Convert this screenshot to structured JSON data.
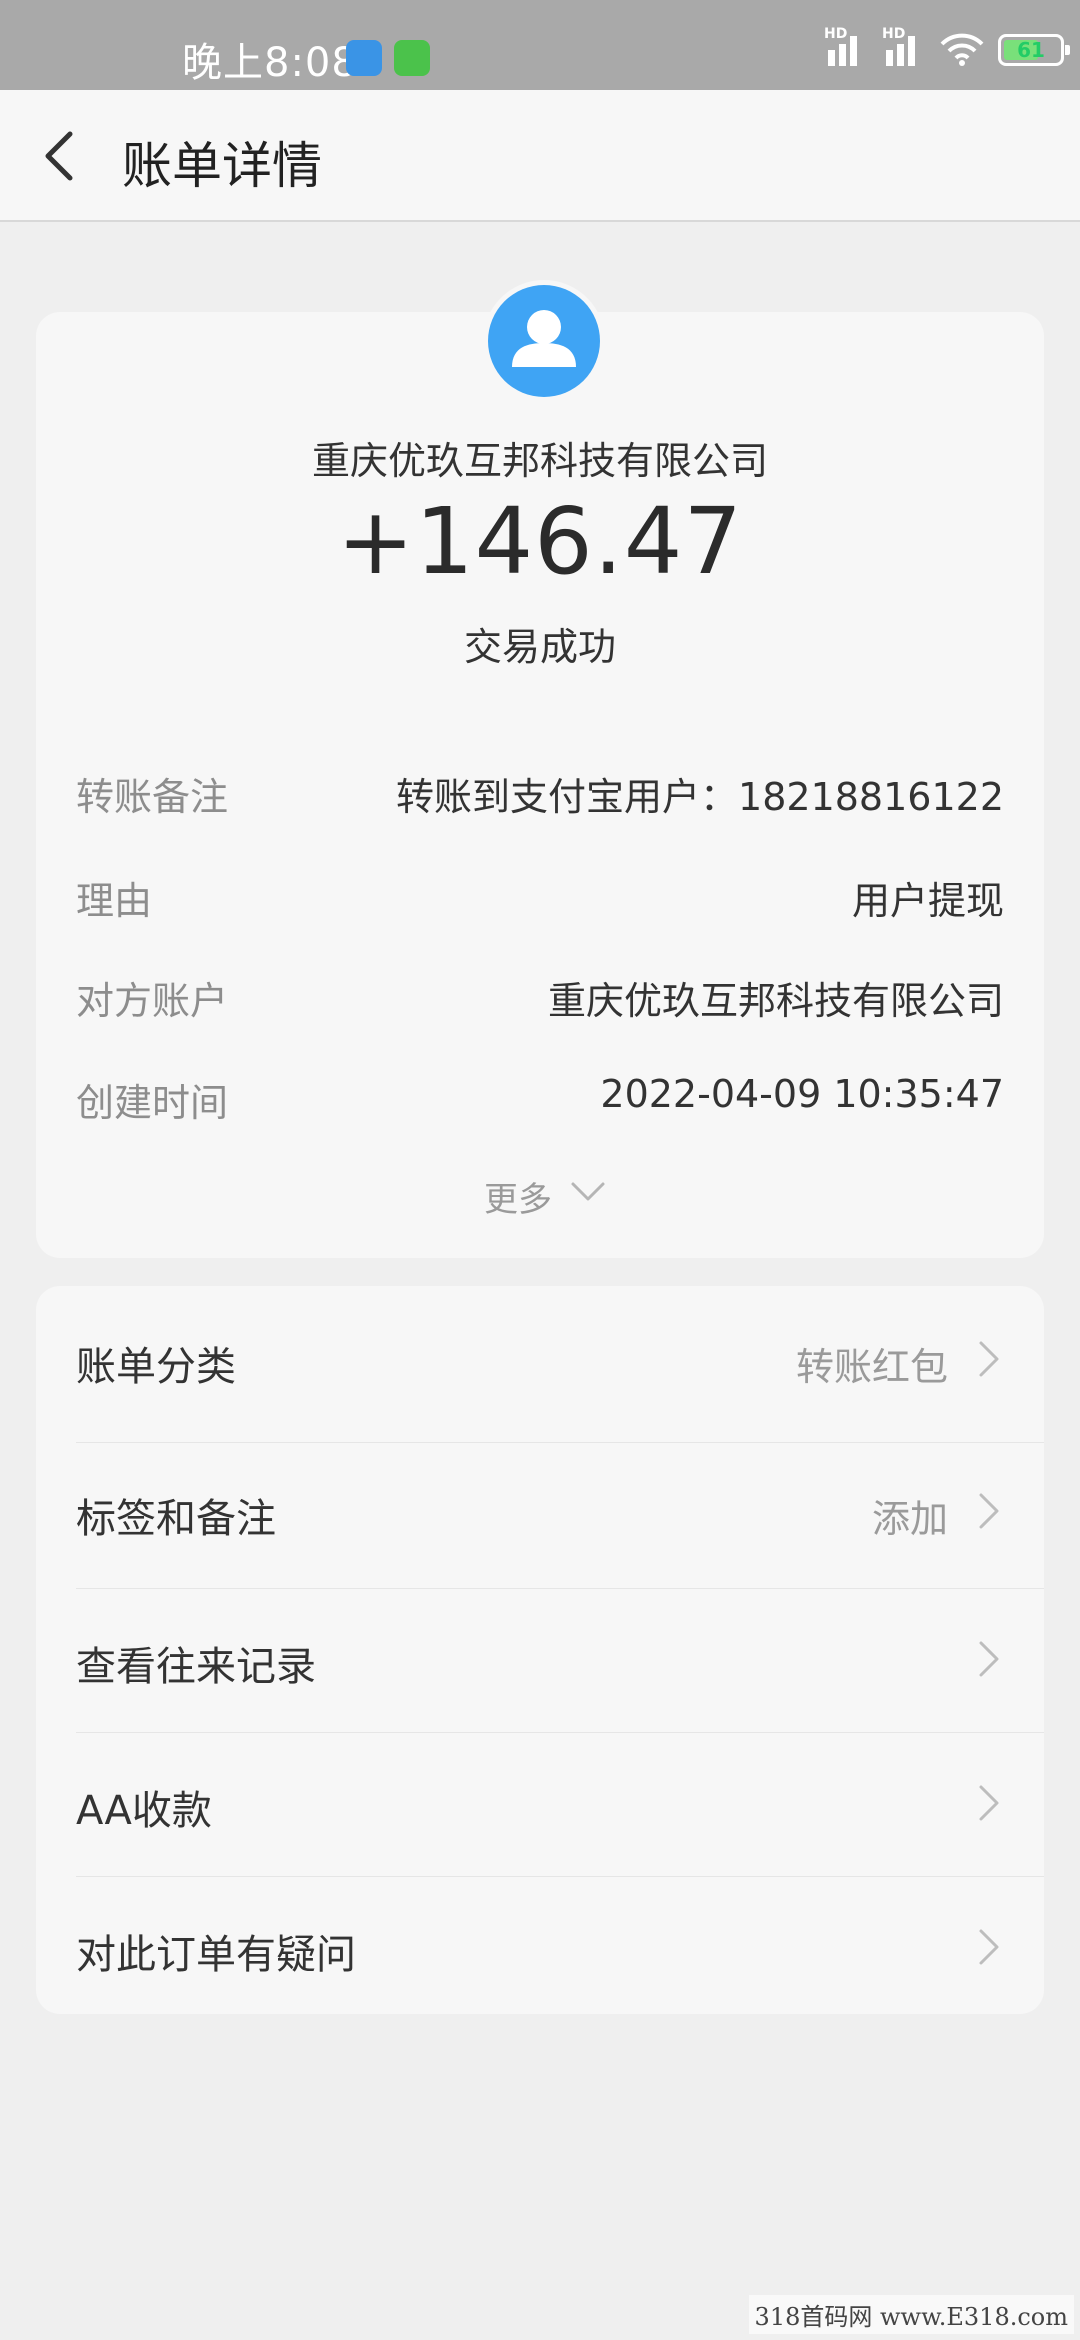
{
  "status_bar": {
    "time": "晚上8:08",
    "hd1": "HD",
    "hd2": "HD",
    "battery": "61",
    "icons": [
      "signal-icon",
      "signal-icon",
      "wifi-icon",
      "battery-icon"
    ]
  },
  "header": {
    "title": "账单详情",
    "back_icon": "back-chevron-icon"
  },
  "summary": {
    "payee": "重庆优玖互邦科技有限公司",
    "amount": "+146.47",
    "status": "交易成功",
    "avatar_icon": "user-avatar-icon",
    "avatar_color": "#3fa4f4"
  },
  "details": [
    {
      "label": "转账备注",
      "value": "转账到支付宝用户：18218816122"
    },
    {
      "label": "理由",
      "value": "用户提现"
    },
    {
      "label": "对方账户",
      "value": "重庆优玖互邦科技有限公司"
    },
    {
      "label": "创建时间",
      "value": "2022-04-09 10:35:47"
    }
  ],
  "more_label": "更多",
  "menu": [
    {
      "label": "账单分类",
      "value": "转账红包"
    },
    {
      "label": "标签和备注",
      "value": "添加"
    },
    {
      "label": "查看往来记录",
      "value": ""
    },
    {
      "label": "AA收款",
      "value": ""
    },
    {
      "label": "对此订单有疑问",
      "value": ""
    }
  ],
  "watermark": "318首码网 www.E318.com"
}
